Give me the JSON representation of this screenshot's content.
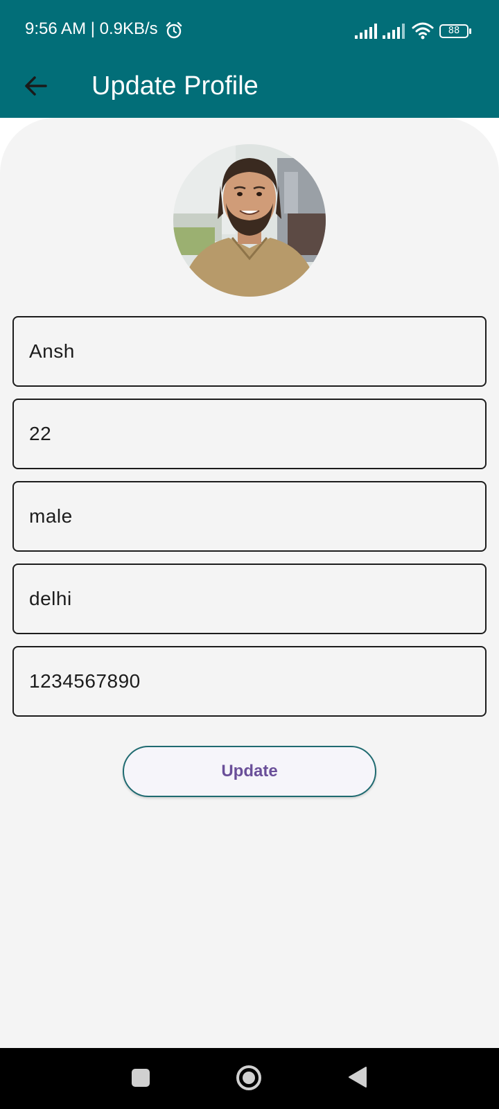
{
  "status_bar": {
    "time_network": "9:56 AM | 0.9KB/s",
    "battery_level": "88",
    "icons": [
      "alarm-icon",
      "cell-signal-icon",
      "cell-signal-icon",
      "wifi-icon",
      "battery-icon"
    ]
  },
  "app_bar": {
    "title": "Update Profile",
    "back_icon": "arrow-left-icon"
  },
  "profile": {
    "avatar": "profile-photo",
    "fields": {
      "name": "Ansh",
      "age": "22",
      "gender": "male",
      "city": "delhi",
      "phone": "1234567890"
    }
  },
  "actions": {
    "update_label": "Update"
  },
  "nav_bar": {
    "icons": [
      "recents-icon",
      "home-icon",
      "back-icon"
    ]
  },
  "colors": {
    "primary": "#026e78",
    "background": "#f4f4f4",
    "button_text": "#6a4f99",
    "button_border": "#1e6a70"
  }
}
